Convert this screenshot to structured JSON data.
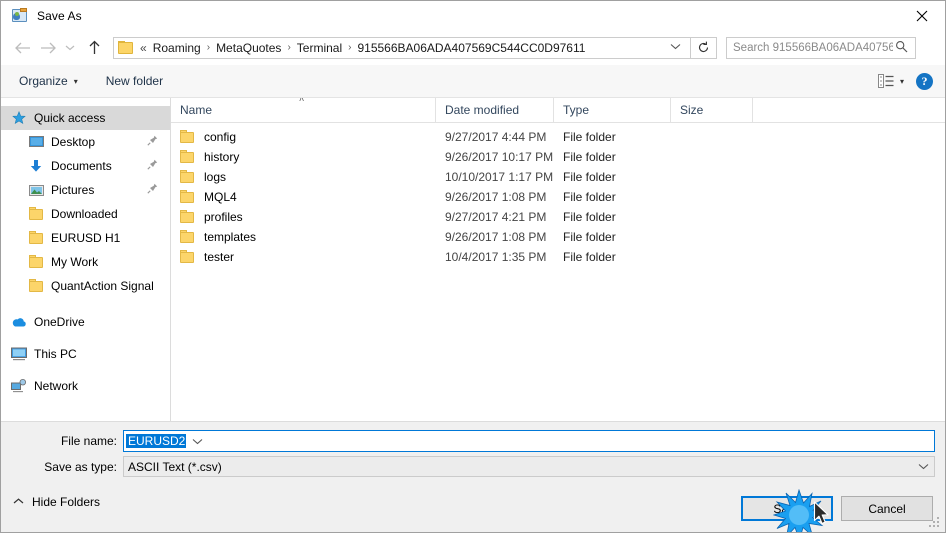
{
  "window": {
    "title": "Save As",
    "title_icon": "save-as-icon",
    "close_icon": "close-icon"
  },
  "nav": {
    "back_icon": "back-arrow-icon",
    "forward_icon": "forward-arrow-icon",
    "recent_icon": "recent-locations-chevron-icon",
    "up_icon": "up-arrow-icon",
    "folder_icon": "folder-icon",
    "breadcrumb_prefix": "«",
    "breadcrumbs": [
      "Roaming",
      "MetaQuotes",
      "Terminal",
      "915566BA06ADA407569C544CC0D97611"
    ],
    "separator": "›",
    "dropdown_icon": "chevron-down-icon",
    "refresh_icon": "refresh-icon"
  },
  "search": {
    "placeholder": "Search 915566BA06ADA40756...",
    "icon": "search-icon"
  },
  "toolbar": {
    "organize_label": "Organize",
    "organize_caret": "▾",
    "new_folder_label": "New folder",
    "view_icon": "view-options-icon",
    "view_caret": "▾",
    "help_label": "?",
    "help_icon": "help-icon"
  },
  "sidebar": {
    "items": [
      {
        "label": "Quick access",
        "icon": "star-icon",
        "selected": true,
        "indent": 0,
        "pinned": false
      },
      {
        "label": "Desktop",
        "icon": "desktop-icon",
        "selected": false,
        "indent": 1,
        "pinned": true
      },
      {
        "label": "Documents",
        "icon": "documents-icon",
        "selected": false,
        "indent": 1,
        "pinned": true
      },
      {
        "label": "Pictures",
        "icon": "pictures-icon",
        "selected": false,
        "indent": 1,
        "pinned": true
      },
      {
        "label": "Downloaded",
        "icon": "folder-icon",
        "selected": false,
        "indent": 1,
        "pinned": false
      },
      {
        "label": "EURUSD H1",
        "icon": "folder-icon",
        "selected": false,
        "indent": 1,
        "pinned": false
      },
      {
        "label": "My Work",
        "icon": "folder-icon",
        "selected": false,
        "indent": 1,
        "pinned": false
      },
      {
        "label": "QuantAction Signal",
        "icon": "folder-icon",
        "selected": false,
        "indent": 1,
        "pinned": false
      },
      {
        "label": "OneDrive",
        "icon": "onedrive-icon",
        "selected": false,
        "indent": 0,
        "pinned": false,
        "gap_before": true
      },
      {
        "label": "This PC",
        "icon": "thispc-icon",
        "selected": false,
        "indent": 0,
        "pinned": false,
        "gap_before": true
      },
      {
        "label": "Network",
        "icon": "network-icon",
        "selected": false,
        "indent": 0,
        "pinned": false,
        "gap_before": true
      }
    ]
  },
  "filelist": {
    "columns": [
      "Name",
      "Date modified",
      "Type",
      "Size"
    ],
    "sort_indicator": "˄",
    "rows": [
      {
        "name": "config",
        "date": "9/27/2017 4:44 PM",
        "type": "File folder",
        "size": ""
      },
      {
        "name": "history",
        "date": "9/26/2017 10:17 PM",
        "type": "File folder",
        "size": ""
      },
      {
        "name": "logs",
        "date": "10/10/2017 1:17 PM",
        "type": "File folder",
        "size": ""
      },
      {
        "name": "MQL4",
        "date": "9/26/2017 1:08 PM",
        "type": "File folder",
        "size": ""
      },
      {
        "name": "profiles",
        "date": "9/27/2017 4:21 PM",
        "type": "File folder",
        "size": ""
      },
      {
        "name": "templates",
        "date": "9/26/2017 1:08 PM",
        "type": "File folder",
        "size": ""
      },
      {
        "name": "tester",
        "date": "10/4/2017 1:35 PM",
        "type": "File folder",
        "size": ""
      }
    ]
  },
  "form": {
    "filename_label": "File name:",
    "filename_value": "EURUSD2",
    "filename_selected": true,
    "savetype_label": "Save as type:",
    "savetype_value": "ASCII Text (*.csv)",
    "caret": "⌄"
  },
  "footer": {
    "hide_folders_label": "Hide Folders",
    "hide_folders_caret": "˄",
    "save_label": "Save",
    "cancel_label": "Cancel",
    "save_focused": true
  },
  "colors": {
    "accent": "#0078d7",
    "folder_yellow": "#fcd56a",
    "dialog_bg": "#f0f0f0",
    "selection_bg": "#d9d9d9",
    "help_blue": "#1474c4"
  }
}
